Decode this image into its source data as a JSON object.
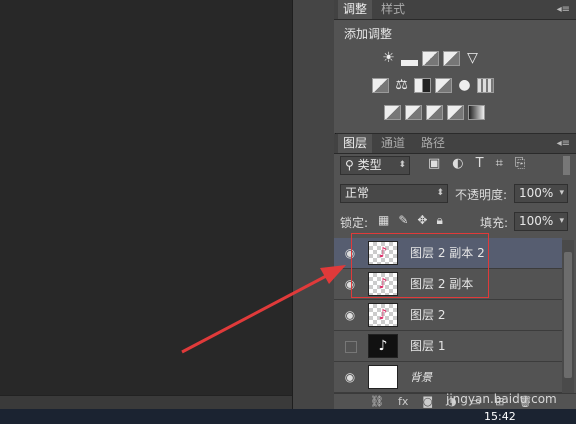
{
  "adjust_panel": {
    "tabs": [
      "调整",
      "样式"
    ],
    "header": "添加调整",
    "rows": [
      [
        "brightness-contrast-icon",
        "levels-icon",
        "curves-icon",
        "exposure-icon",
        "vibrance-icon"
      ],
      [
        "hue-saturation-icon",
        "color-balance-icon",
        "black-white-icon",
        "photo-filter-icon",
        "channel-mixer-icon",
        "color-lookup-icon"
      ],
      [
        "invert-icon",
        "posterize-icon",
        "threshold-icon",
        "selective-color-icon",
        "gradient-map-icon"
      ]
    ]
  },
  "layers_panel": {
    "tabs": [
      "图层",
      "通道",
      "路径"
    ],
    "filter_label": "类型",
    "blend_mode": "正常",
    "opacity_label": "不透明度:",
    "opacity_value": "100%",
    "lock_label": "锁定:",
    "fill_label": "填充:",
    "fill_value": "100%",
    "layers": [
      {
        "name": "图层 2 副本 2",
        "visible": true,
        "selected": true,
        "thumb": "tiktok-pink"
      },
      {
        "name": "图层 2 副本",
        "visible": true,
        "selected": false,
        "thumb": "tiktok-pink"
      },
      {
        "name": "图层 2",
        "visible": true,
        "selected": false,
        "thumb": "tiktok-pink"
      },
      {
        "name": "图层 1",
        "visible": false,
        "selected": false,
        "thumb": "tiktok-black"
      },
      {
        "name": "背景",
        "visible": true,
        "selected": false,
        "thumb": "white"
      }
    ]
  },
  "taskbar": {
    "clock": "15:42"
  },
  "watermark": "jingyan.baidu.com",
  "colors": {
    "highlight_box": "#e03a3a",
    "arrow": "#e03a3a",
    "selected_layer": "#565d70"
  }
}
